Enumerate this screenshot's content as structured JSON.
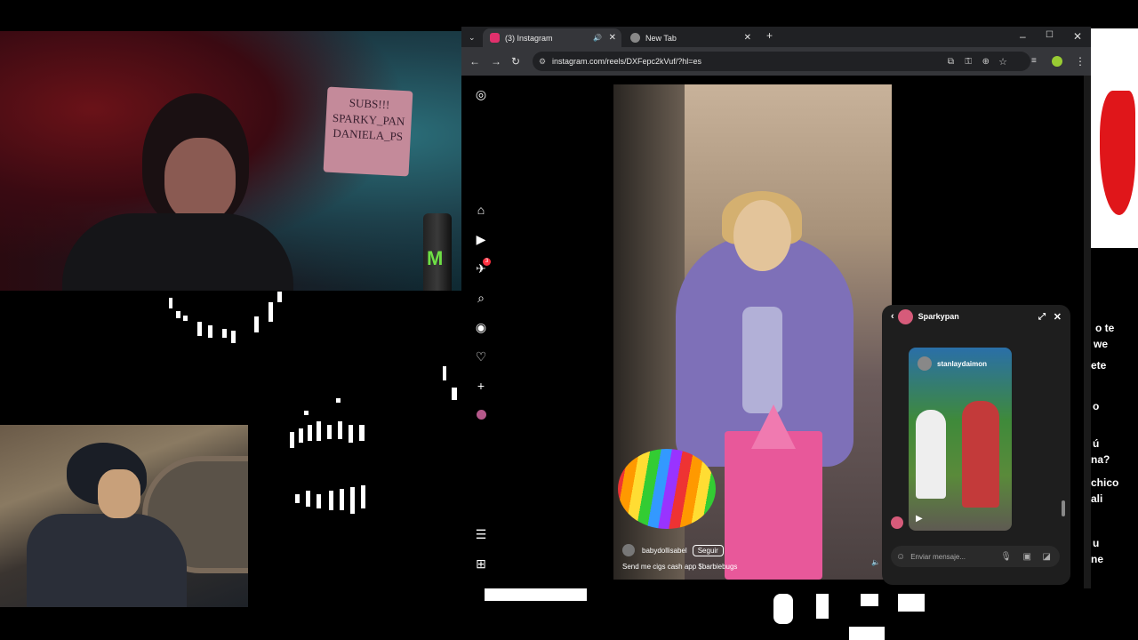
{
  "webcam": {
    "sign_lines": [
      "SUBS!!!",
      "SPARKY_PAN",
      "DANIELA_PS"
    ],
    "can_logo": "M"
  },
  "browser": {
    "tabs": [
      {
        "label": "(3) Instagram",
        "active": true,
        "icon_color": "#e1306c"
      },
      {
        "label": "New Tab",
        "active": false,
        "icon_color": "#888888"
      }
    ],
    "new_tab_label": "+",
    "url": "instagram.com/reels/DXFepc2kVuf/?hl=es"
  },
  "instagram": {
    "nav_badge": "3",
    "reel": {
      "username": "babydollisabel",
      "follow_label": "Seguir",
      "caption": "Send me cigs cash app $barbiebugs"
    },
    "chat": {
      "name": "Sparkypan",
      "shared_user": "stanlaydaimon",
      "input_placeholder": "Enviar mensaje..."
    }
  },
  "side_text": [
    "o te",
    "we",
    "ete",
    "o",
    "ú",
    "na?",
    "chico",
    "ali",
    "u",
    "ne"
  ]
}
